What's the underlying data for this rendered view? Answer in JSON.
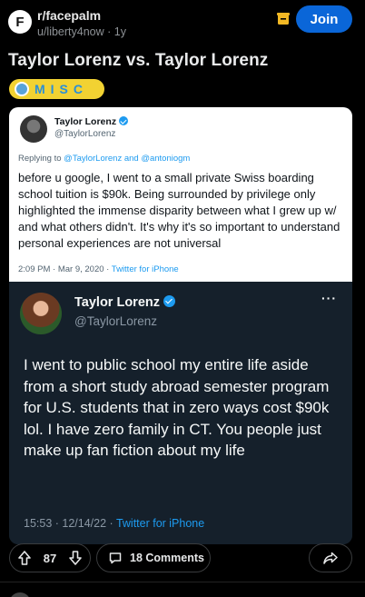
{
  "header": {
    "subreddit": "r/facepalm",
    "meta": "u/liberty4now · 1y",
    "subreddit_icon_letter": "F",
    "join_label": "Join"
  },
  "post": {
    "title": "Taylor Lorenz vs. Taylor Lorenz",
    "flair": "MISC"
  },
  "tweet_top": {
    "name": "Taylor Lorenz",
    "handle": "@TaylorLorenz",
    "reply_prefix": "Replying to",
    "reply_to": "@TaylorLorenz and @antoniogm",
    "text": "before u google, I went to a small private Swiss boarding school tuition is $90k. Being surrounded by privilege only highlighted the immense disparity between what I grew up w/ and what others didn't. It's why it's so important to understand personal experiences are not universal",
    "timestamp": "2:09 PM · Mar 9, 2020 ·",
    "source": "Twitter for iPhone"
  },
  "tweet_bottom": {
    "name": "Taylor Lorenz",
    "handle": "@TaylorLorenz",
    "more": "···",
    "text": "I went to public school my entire life aside from a short study abroad semester program for U.S. students that in zero ways cost $90k lol. I have zero family in CT. You people just make up fan fiction about my life",
    "timestamp": "15:53 · 12/14/22 ·",
    "source": "Twitter for iPhone"
  },
  "actions": {
    "vote_count": "87",
    "comments_label": "18 Comments"
  },
  "colors": {
    "join_button": "#0a66d8",
    "flair_bg": "#f2d232",
    "twitter_blue": "#1d9bf0",
    "save_icon": "#f2b824"
  }
}
